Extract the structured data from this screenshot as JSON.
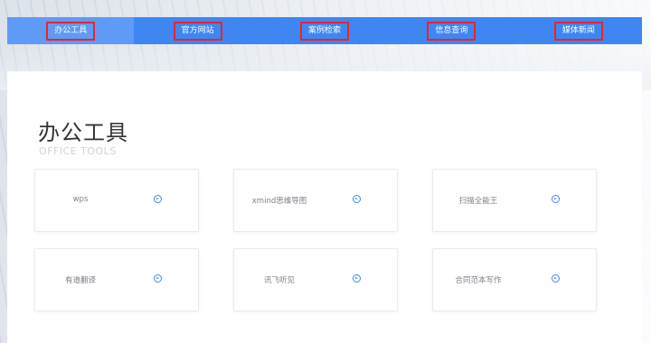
{
  "nav": {
    "items": [
      {
        "label": "办公工具",
        "active": true
      },
      {
        "label": "官方网站",
        "active": false
      },
      {
        "label": "案例检索",
        "active": false
      },
      {
        "label": "信息查询",
        "active": false
      },
      {
        "label": "媒体新闻",
        "active": false
      }
    ]
  },
  "section": {
    "title": "办公工具",
    "subtitle": "OFFICE TOOLS"
  },
  "cards": [
    {
      "name": "wps",
      "icon": "arrow-circle-icon"
    },
    {
      "name": "xmind思维导图",
      "icon": "arrow-circle-icon"
    },
    {
      "name": "扫描全能王",
      "icon": "arrow-circle-icon"
    },
    {
      "name": "有道翻译",
      "icon": "arrow-circle-icon"
    },
    {
      "name": "讯飞听见",
      "icon": "arrow-circle-icon"
    },
    {
      "name": "合同范本写作",
      "icon": "arrow-circle-icon"
    }
  ],
  "colors": {
    "accent": "#3f86f2",
    "highlight_border": "#e6252b"
  }
}
